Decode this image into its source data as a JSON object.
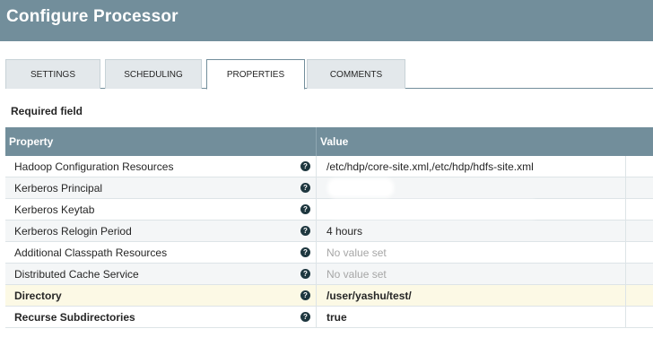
{
  "window": {
    "title": "Configure Processor"
  },
  "tabs": [
    {
      "label": "SETTINGS",
      "active": false
    },
    {
      "label": "SCHEDULING",
      "active": false
    },
    {
      "label": "PROPERTIES",
      "active": true
    },
    {
      "label": "COMMENTS",
      "active": false
    }
  ],
  "required_label": "Required field",
  "table": {
    "columns": {
      "property": "Property",
      "value": "Value"
    },
    "help_icon_glyph": "?",
    "rows": [
      {
        "name": "Hadoop Configuration Resources",
        "value": "/etc/hdp/core-site.xml,/etc/hdp/hdfs-site.xml",
        "state": "set",
        "required": false
      },
      {
        "name": "Kerberos Principal",
        "value": "",
        "state": "redacted",
        "required": false
      },
      {
        "name": "Kerberos Keytab",
        "value": "",
        "state": "redacted",
        "required": false
      },
      {
        "name": "Kerberos Relogin Period",
        "value": "4 hours",
        "state": "set",
        "required": false
      },
      {
        "name": "Additional Classpath Resources",
        "value": "No value set",
        "state": "unset",
        "required": false
      },
      {
        "name": "Distributed Cache Service",
        "value": "No value set",
        "state": "unset",
        "required": false
      },
      {
        "name": "Directory",
        "value": "/user/yashu/test/",
        "state": "set",
        "required": true,
        "highlighted": true
      },
      {
        "name": "Recurse Subdirectories",
        "value": "true",
        "state": "set",
        "required": true
      }
    ]
  },
  "colors": {
    "header_bg": "#728e9b",
    "tab_bg": "#e3e8eb",
    "highlight_row": "#fcf9e5",
    "help_icon": "#1e373f"
  }
}
